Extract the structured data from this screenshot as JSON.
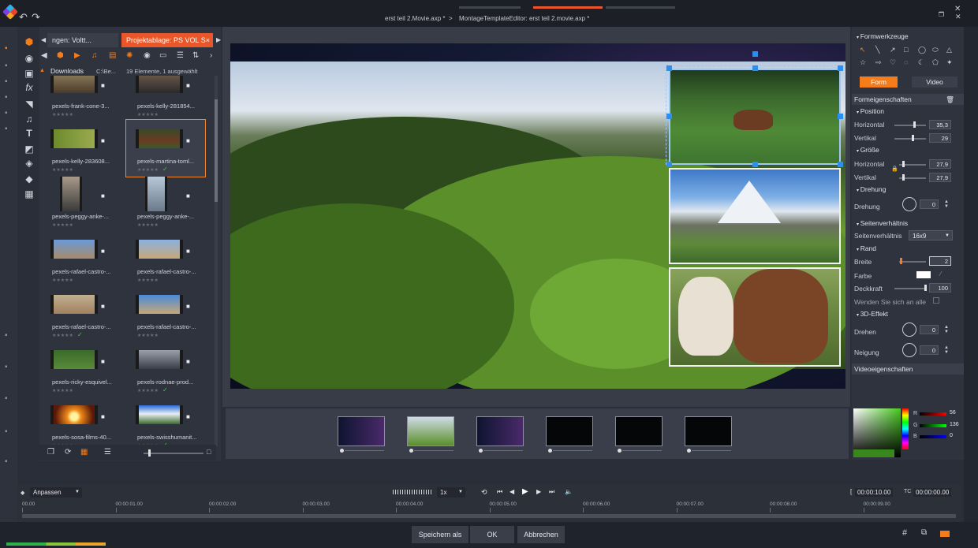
{
  "titlebar": {
    "crumb1": "erst teil 2.Movie.axp *",
    "sep": ">",
    "crumb2": "MontageTemplateEditor: erst teil 2.movie.axp *"
  },
  "library": {
    "tabs": [
      "ngen: Voltt...",
      "Projektablage: PS VOL S"
    ],
    "tab_close": "×",
    "path_folder": "Downloads",
    "path_location": "C:\\Be...",
    "path_count": "19 Elemente, 1 ausgewählt",
    "items": [
      {
        "name": "pexels-frank-cone-3...",
        "check": false
      },
      {
        "name": "pexels-kelly-281854...",
        "check": false
      },
      {
        "name": "pexels-kelly-283608...",
        "check": false
      },
      {
        "name": "pexels-martina-toml...",
        "check": true
      },
      {
        "name": "pexels-peggy-anke-...",
        "check": false
      },
      {
        "name": "pexels-peggy-anke-...",
        "check": false
      },
      {
        "name": "pexels-rafael-castro-...",
        "check": false
      },
      {
        "name": "pexels-rafael-castro-...",
        "check": false
      },
      {
        "name": "pexels-rafael-castro-...",
        "check": true
      },
      {
        "name": "pexels-rafael-castro-...",
        "check": false
      },
      {
        "name": "pexels-ricky-esquivel...",
        "check": false
      },
      {
        "name": "pexels-rodnae-prod...",
        "check": true
      },
      {
        "name": "pexels-sosa-films-40...",
        "check": false
      },
      {
        "name": "pexels-swisshumanit...",
        "check": true
      }
    ],
    "stars": "★★★★★"
  },
  "props": {
    "tools_title": "Formwerkzeuge",
    "btn_form": "Form",
    "btn_video": "Video",
    "shape_props": "Formeigenschaften",
    "position": "Position",
    "horizontal": "Horizontal",
    "vertikal": "Vertikal",
    "pos_h": "35,3",
    "pos_v": "29",
    "groesse": "Größe",
    "size_h": "27,9",
    "size_v": "27,9",
    "drehung_sec": "Drehung",
    "drehung": "Drehung",
    "rot": "0",
    "aspect_sec": "Seitenverhältnis",
    "aspect_lbl": "Seitenverhältnis",
    "aspect_val": "16x9",
    "rand": "Rand",
    "breite": "Breite",
    "breite_val": "2",
    "farbe": "Farbe",
    "deckkraft": "Deckkraft",
    "deckkraft_val": "100",
    "apply_all": "Wenden Sie sich an alle",
    "effect3d": "3D-Effekt",
    "drehen": "Drehen",
    "drehen_val": "0",
    "neigung": "Neigung",
    "neigung_val": "0",
    "video_props": "Videoeigenschaften",
    "rgb": {
      "r": "56",
      "g": "136",
      "b": "0"
    },
    "rgb_labels": {
      "r": "R",
      "g": "G",
      "b": "B"
    }
  },
  "timeline": {
    "fit": "Anpassen",
    "speed": "1x",
    "ticks": [
      "00.00",
      "00:00:01.00",
      "00:00:02.00",
      "00:00:03.00",
      "00:00:04.00",
      "00:00:05.00",
      "00:00:06.00",
      "00:00:07.00",
      "00:00:08.00",
      "00:00:09.00"
    ],
    "duration": "00:00:10.00",
    "tc_label": "TC",
    "timecode": "00:00:00.00"
  },
  "footer": {
    "save_as": "Speichern als",
    "ok": "OK",
    "cancel": "Abbrechen"
  }
}
